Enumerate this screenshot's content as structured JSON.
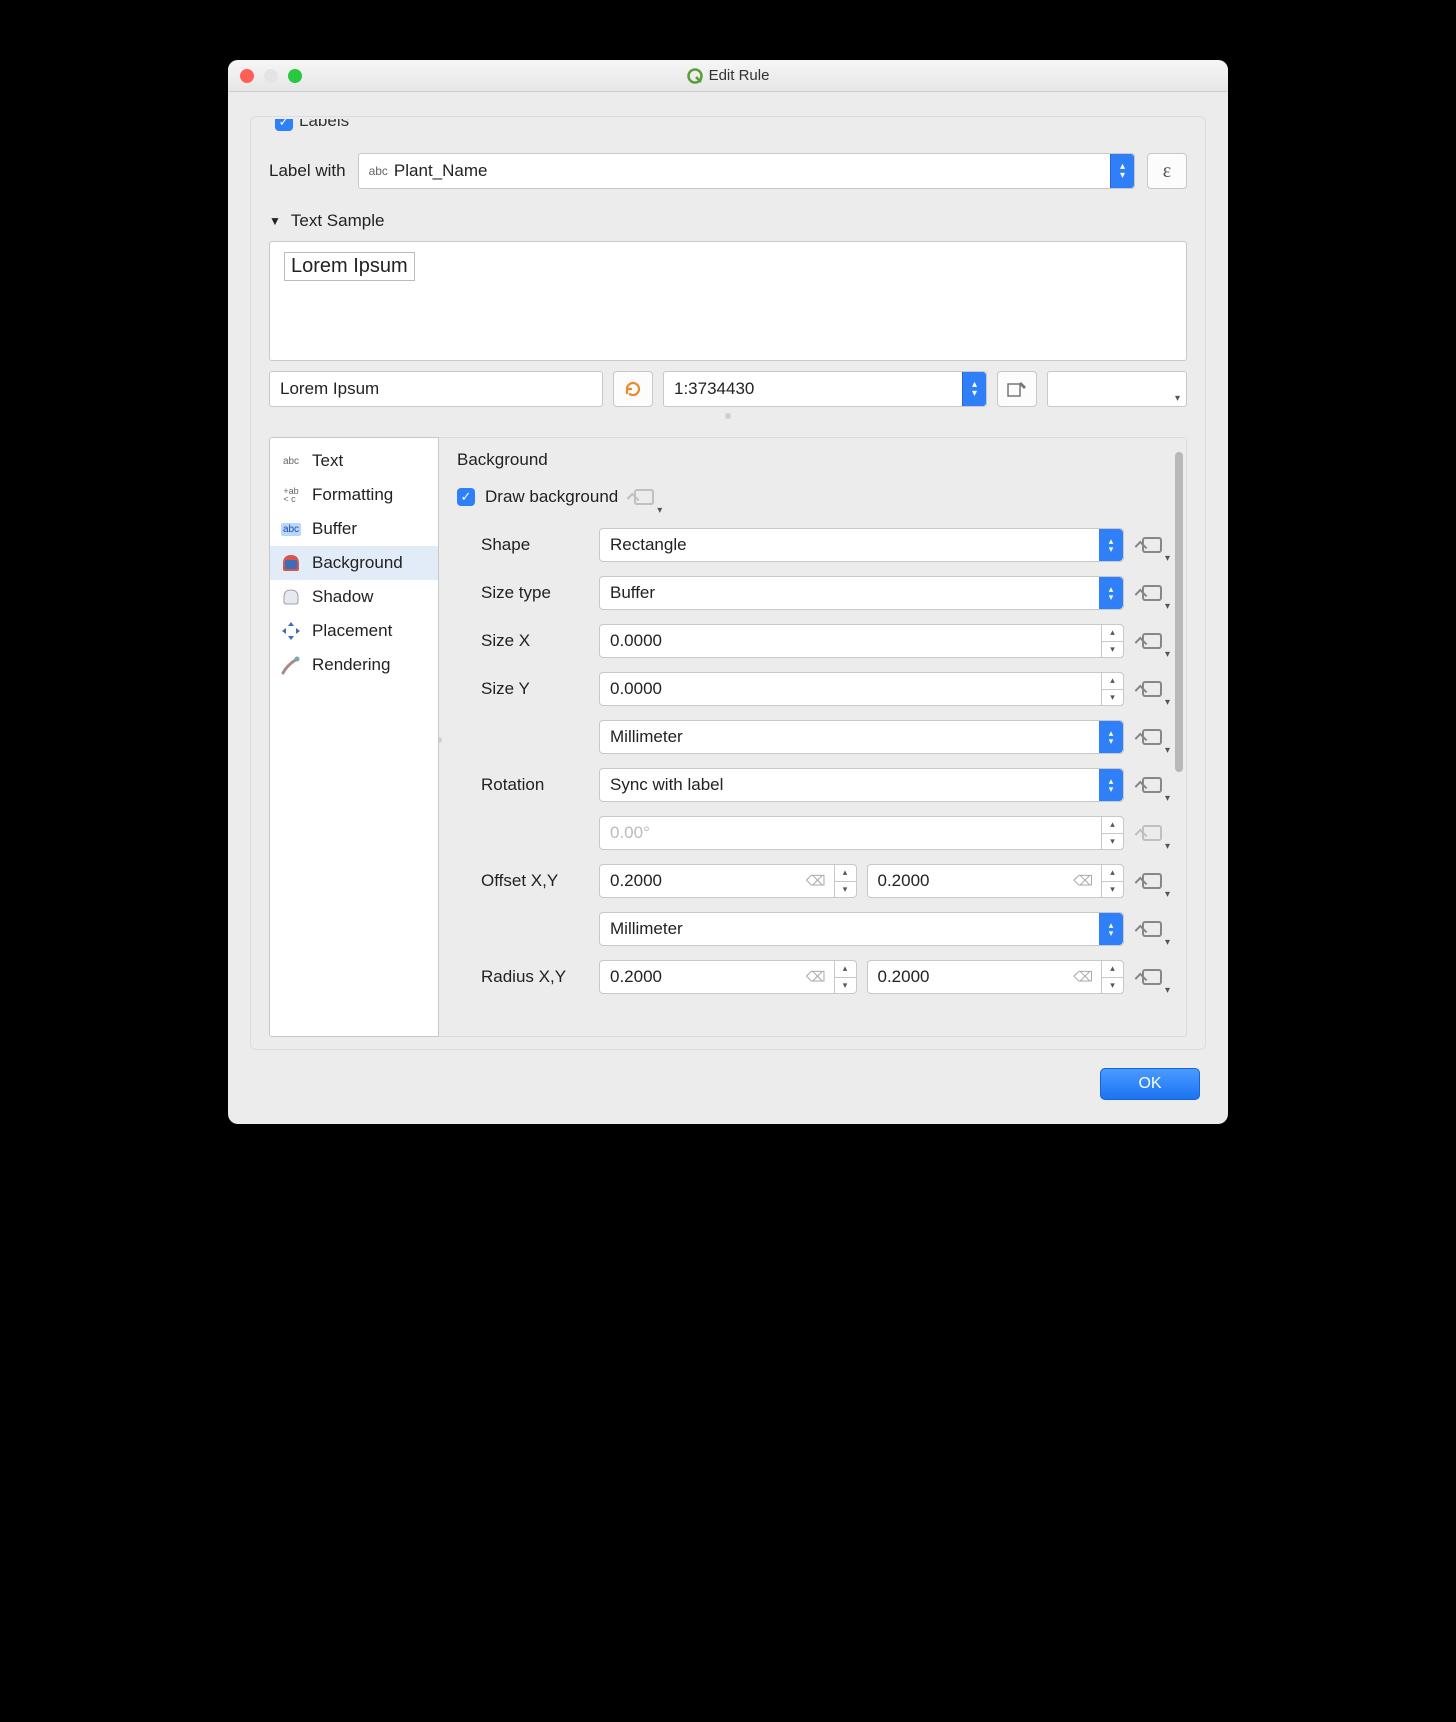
{
  "window": {
    "title": "Edit Rule"
  },
  "header": {
    "labels_checked": true,
    "labels_text": "Labels"
  },
  "label_with": {
    "label": "Label with",
    "prefix": "abc",
    "value": "Plant_Name",
    "expr": "ε"
  },
  "sample": {
    "title": "Text Sample",
    "preview": "Lorem Ipsum",
    "input": "Lorem Ipsum",
    "scale": "1:3734430"
  },
  "sidebar": {
    "items": [
      {
        "label": "Text"
      },
      {
        "label": "Formatting"
      },
      {
        "label": "Buffer"
      },
      {
        "label": "Background"
      },
      {
        "label": "Shadow"
      },
      {
        "label": "Placement"
      },
      {
        "label": "Rendering"
      }
    ],
    "selected": 3
  },
  "bg": {
    "title": "Background",
    "draw_label": "Draw background",
    "draw_checked": true,
    "shape_lbl": "Shape",
    "shape_val": "Rectangle",
    "sizetype_lbl": "Size type",
    "sizetype_val": "Buffer",
    "sizex_lbl": "Size X",
    "sizex_val": "0.0000",
    "sizey_lbl": "Size Y",
    "sizey_val": "0.0000",
    "size_unit": "Millimeter",
    "rot_lbl": "Rotation",
    "rot_val": "Sync with label",
    "rot_deg": "0.00°",
    "offset_lbl": "Offset X,Y",
    "offset_x": "0.2000",
    "offset_y": "0.2000",
    "offset_unit": "Millimeter",
    "radius_lbl": "Radius X,Y",
    "radius_x": "0.2000",
    "radius_y": "0.2000"
  },
  "footer": {
    "ok": "OK"
  }
}
